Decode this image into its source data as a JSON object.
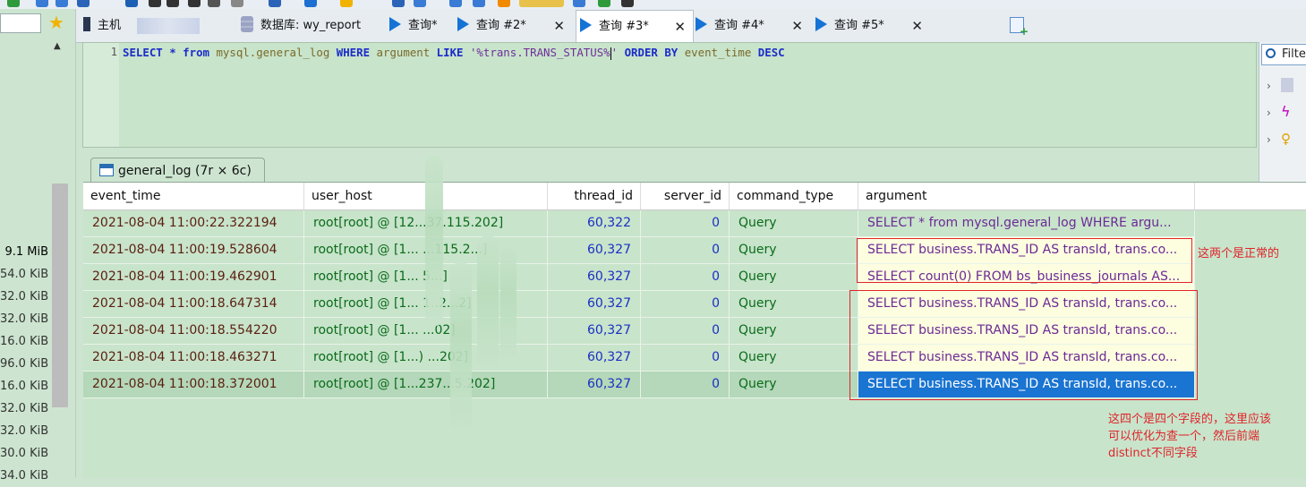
{
  "tabs": [
    {
      "label": "主机",
      "icon": "host-icon",
      "active": false,
      "closable": false
    },
    {
      "label": "数据库: wy_report",
      "icon": "database-icon",
      "active": false,
      "closable": false
    },
    {
      "label": "查询*",
      "icon": "query-icon",
      "active": false,
      "closable": false
    },
    {
      "label": "查询 #2*",
      "icon": "query-icon",
      "active": false,
      "closable": true
    },
    {
      "label": "查询 #3*",
      "icon": "query-icon",
      "active": true,
      "closable": true
    },
    {
      "label": "查询 #4*",
      "icon": "query-icon",
      "active": false,
      "closable": true
    },
    {
      "label": "查询 #5*",
      "icon": "query-icon",
      "active": false,
      "closable": true
    }
  ],
  "close_glyph": "✕",
  "editor": {
    "line_number": "1",
    "sql_parts": [
      "SELECT",
      " * ",
      "from",
      " mysql.general_log ",
      "WHERE",
      " argument ",
      "LIKE",
      " '%trans.TRANS_STATUS%",
      "' ",
      "ORDER BY",
      " event_time ",
      "DESC"
    ]
  },
  "right_panel": {
    "filter_label": "Filte"
  },
  "left_panel": {
    "sizes": [
      "9.1 MiB",
      "54.0 KiB",
      "32.0 KiB",
      "32.0 KiB",
      "16.0 KiB",
      "96.0 KiB",
      "16.0 KiB",
      "32.0 KiB",
      "32.0 KiB",
      "30.0 KiB",
      "34.0 KiB"
    ]
  },
  "result": {
    "tab_label": "general_log (7r × 6c)",
    "columns": [
      "event_time",
      "user_host",
      "thread_id",
      "server_id",
      "command_type",
      "argument"
    ],
    "rows": [
      {
        "event_time": "2021-08-04 11:00:22.322194",
        "user_host": "root[root] @  [12...37.115.202]",
        "thread_id": "60,322",
        "server_id": "0",
        "command_type": "Query",
        "argument": "SELECT * from mysql.general_log WHERE argu..."
      },
      {
        "event_time": "2021-08-04 11:00:19.528604",
        "user_host": "root[root] @  [1...  ...115.2...]",
        "thread_id": "60,327",
        "server_id": "0",
        "command_type": "Query",
        "argument": "SELECT business.TRANS_ID AS transId, trans.co..."
      },
      {
        "event_time": "2021-08-04 11:00:19.462901",
        "user_host": "root[root] @  [1...      5...]",
        "thread_id": "60,327",
        "server_id": "0",
        "command_type": "Query",
        "argument": "SELECT count(0) FROM bs_business_journals AS..."
      },
      {
        "event_time": "2021-08-04 11:00:18.647314",
        "user_host": "root[root] @  [1...     1..2...2]",
        "thread_id": "60,327",
        "server_id": "0",
        "command_type": "Query",
        "argument": "SELECT business.TRANS_ID AS transId, trans.co..."
      },
      {
        "event_time": "2021-08-04 11:00:18.554220",
        "user_host": "root[root] @  [1...     ...02]",
        "thread_id": "60,327",
        "server_id": "0",
        "command_type": "Query",
        "argument": "SELECT business.TRANS_ID AS transId, trans.co..."
      },
      {
        "event_time": "2021-08-04 11:00:18.463271",
        "user_host": "root[root] @  [1...)  ...202]",
        "thread_id": "60,327",
        "server_id": "0",
        "command_type": "Query",
        "argument": "SELECT business.TRANS_ID AS transId, trans.co..."
      },
      {
        "event_time": "2021-08-04 11:00:18.372001",
        "user_host": "root[root] @  [1...237...5.202]",
        "thread_id": "60,327",
        "server_id": "0",
        "command_type": "Query",
        "argument": "SELECT business.TRANS_ID AS transId, trans.co..."
      }
    ],
    "selected_row": 6
  },
  "annotations": {
    "note_normal": "这两个是正常的",
    "note_optimize": "这四个是四个字段的，这里应该\n可以优化为查一个，然后前端\ndistinct不同字段"
  },
  "colors": {
    "grid_bg": "#c8e4cb",
    "selection": "#1a74d1",
    "annotation_red": "#e0242a",
    "keyword_blue": "#1c2cc9"
  }
}
